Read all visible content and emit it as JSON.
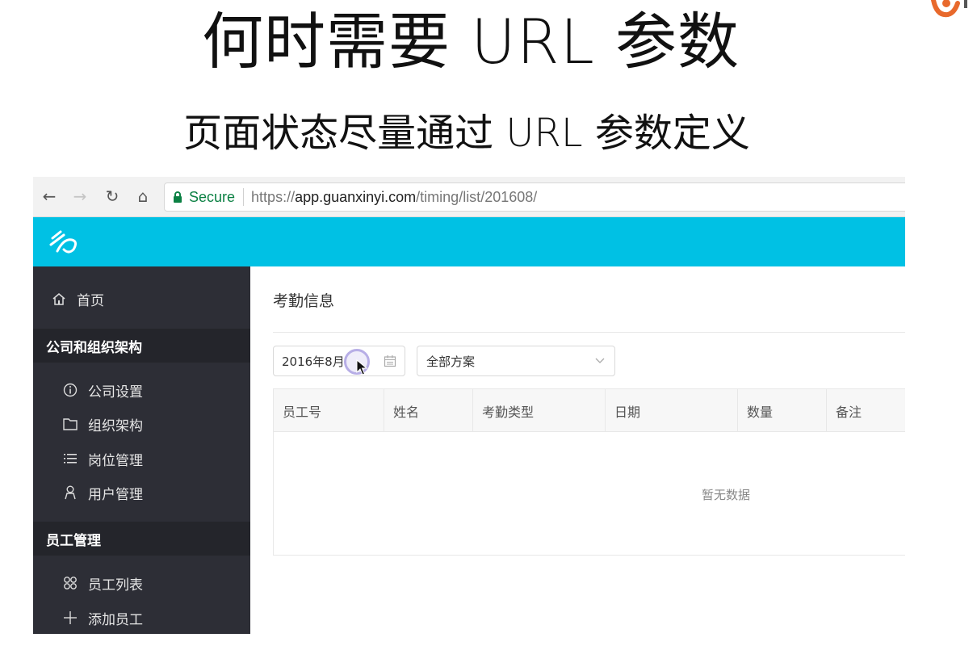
{
  "slide": {
    "title": "何时需要 URL 参数",
    "subtitle": "页面状态尽量通过 URL 参数定义"
  },
  "browser": {
    "secure_label": "Secure",
    "url_scheme": "https://",
    "url_host": "app.guanxinyi.com",
    "url_path": "/timing/list/201608/"
  },
  "sidebar": {
    "home": "首页",
    "groups": [
      {
        "title": "公司和组织架构",
        "items": [
          "公司设置",
          "组织架构",
          "岗位管理",
          "用户管理"
        ]
      },
      {
        "title": "员工管理",
        "items": [
          "员工列表",
          "添加员工"
        ]
      }
    ]
  },
  "main": {
    "page_title": "考勤信息",
    "date_value": "2016年8月",
    "scheme_value": "全部方案",
    "table": {
      "columns": [
        "员工号",
        "姓名",
        "考勤类型",
        "日期",
        "数量",
        "备注"
      ],
      "empty_text": "暂无数据"
    }
  },
  "colors": {
    "header": "#00c1e4",
    "sidebar": "#2d2e36",
    "sidebar_group": "#24252b",
    "secure": "#0b8043"
  },
  "icons": [
    "back-icon",
    "forward-icon",
    "reload-icon",
    "home-icon",
    "lock-icon",
    "app-logo",
    "house-icon",
    "info-icon",
    "folder-icon",
    "list-icon",
    "user-icon",
    "grid-icon",
    "plus-icon",
    "calendar-icon",
    "chevron-down-icon"
  ]
}
